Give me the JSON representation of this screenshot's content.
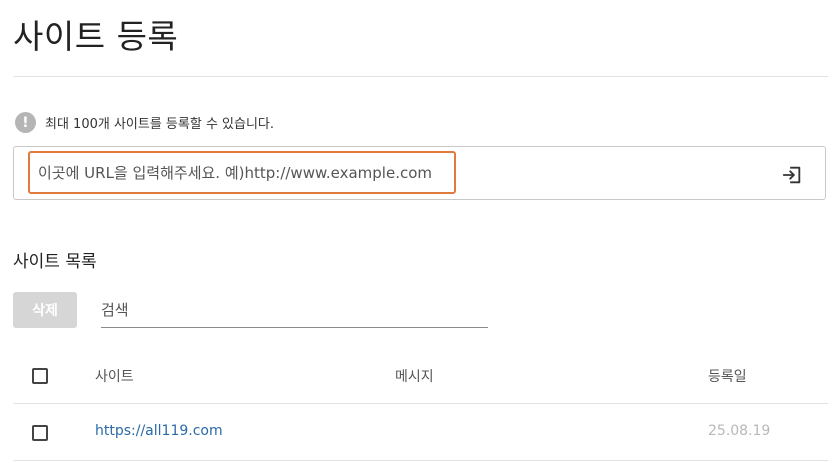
{
  "page": {
    "title": "사이트 등록"
  },
  "notice": {
    "icon": "exclamation-icon",
    "text": "최대 100개 사이트를 등록할 수 있습니다."
  },
  "url_form": {
    "placeholder": "이곳에 URL을 입력해주세요. 예)http://www.example.com",
    "value": "",
    "submit_icon": "enter-icon",
    "highlight_color": "#e07a3f"
  },
  "site_list": {
    "title": "사이트 목록",
    "delete_label": "삭제",
    "search_placeholder": "검색",
    "columns": {
      "site": "사이트",
      "message": "메시지",
      "date": "등록일"
    },
    "rows": [
      {
        "site": "https://all119.com",
        "message": "",
        "date": "25.08.19",
        "checked": false
      }
    ]
  },
  "colors": {
    "link": "#2b6aa8",
    "delete_button_bg": "#d6d6d6",
    "date_text": "#b8b8b8"
  }
}
